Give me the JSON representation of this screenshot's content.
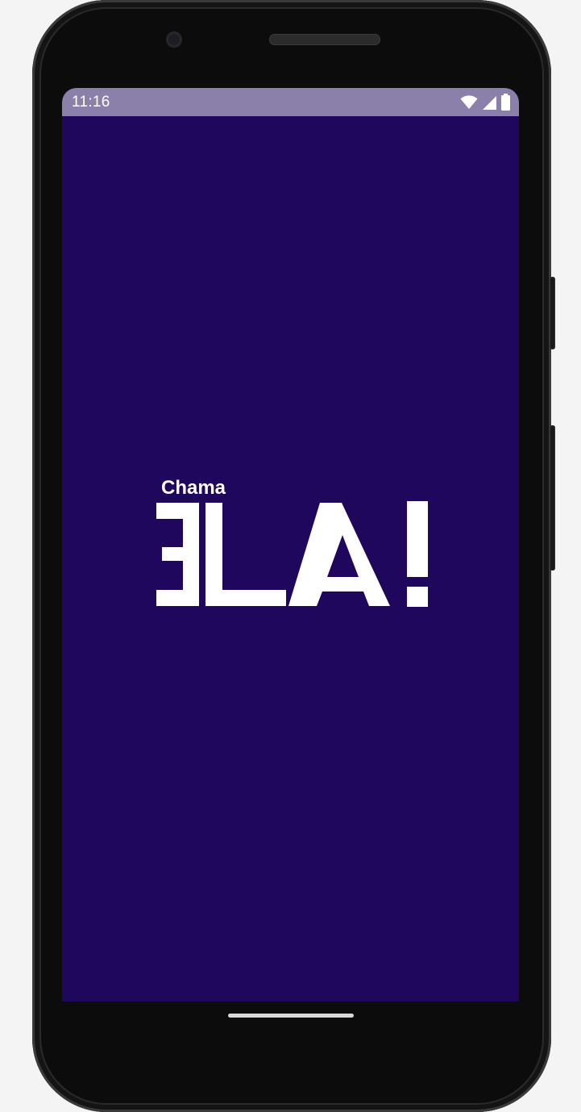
{
  "status_bar": {
    "time": "11:16",
    "icons": [
      "wifi-icon",
      "cellular-signal-icon",
      "battery-icon"
    ],
    "background": "#8a80aa"
  },
  "splash": {
    "background": "#1f075d",
    "logo": {
      "small_text": "Chama",
      "main_text": "ELA!",
      "color": "#ffffff"
    }
  },
  "navigation": {
    "home_indicator": "home-indicator"
  }
}
